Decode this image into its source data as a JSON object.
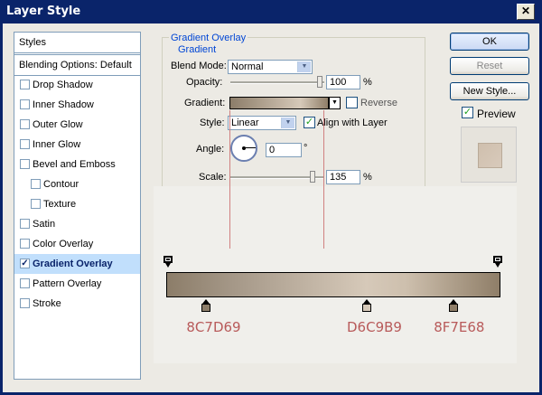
{
  "window": {
    "title": "Layer Style",
    "close_label": "✕"
  },
  "left_panel": {
    "header": "Styles",
    "blending": "Blending Options: Default",
    "items": [
      {
        "label": "Drop Shadow",
        "checked": false
      },
      {
        "label": "Inner Shadow",
        "checked": false
      },
      {
        "label": "Outer Glow",
        "checked": false
      },
      {
        "label": "Inner Glow",
        "checked": false
      },
      {
        "label": "Bevel and Emboss",
        "checked": false
      },
      {
        "label": "Contour",
        "checked": false
      },
      {
        "label": "Texture",
        "checked": false
      },
      {
        "label": "Satin",
        "checked": false
      },
      {
        "label": "Color Overlay",
        "checked": false
      },
      {
        "label": "Gradient Overlay",
        "checked": true
      },
      {
        "label": "Pattern Overlay",
        "checked": false
      },
      {
        "label": "Stroke",
        "checked": false
      }
    ]
  },
  "panel": {
    "title": "Gradient Overlay",
    "subtitle": "Gradient",
    "blend_mode_label": "Blend Mode:",
    "blend_mode_value": "Normal",
    "opacity_label": "Opacity:",
    "opacity_value": "100",
    "opacity_unit": "%",
    "opacity_level": 1.0,
    "gradient_label": "Gradient:",
    "reverse_label": "Reverse",
    "reverse_checked": false,
    "style_label": "Style:",
    "style_value": "Linear",
    "align_label": "Align with Layer",
    "align_checked": true,
    "angle_label": "Angle:",
    "angle_value": "0",
    "angle_unit": "°",
    "scale_label": "Scale:",
    "scale_value": "135",
    "scale_unit": "%"
  },
  "gradient_editor": {
    "stops": [
      {
        "hex": "8C7D69",
        "color": "#8c7d69",
        "location": 0.12
      },
      {
        "hex": "D6C9B9",
        "color": "#d6c9b9",
        "location": 0.6
      },
      {
        "hex": "8F7E68",
        "color": "#8f7e68",
        "location": 0.86
      }
    ]
  },
  "buttons": {
    "ok": "OK",
    "reset": "Reset",
    "new_style": "New Style...",
    "preview_label": "Preview",
    "preview_checked": true
  },
  "colors": {
    "titlebar": "#0a246a",
    "accent_text": "#0046d5",
    "annotation": "#b85a5a",
    "selection": "#c1dffc"
  }
}
